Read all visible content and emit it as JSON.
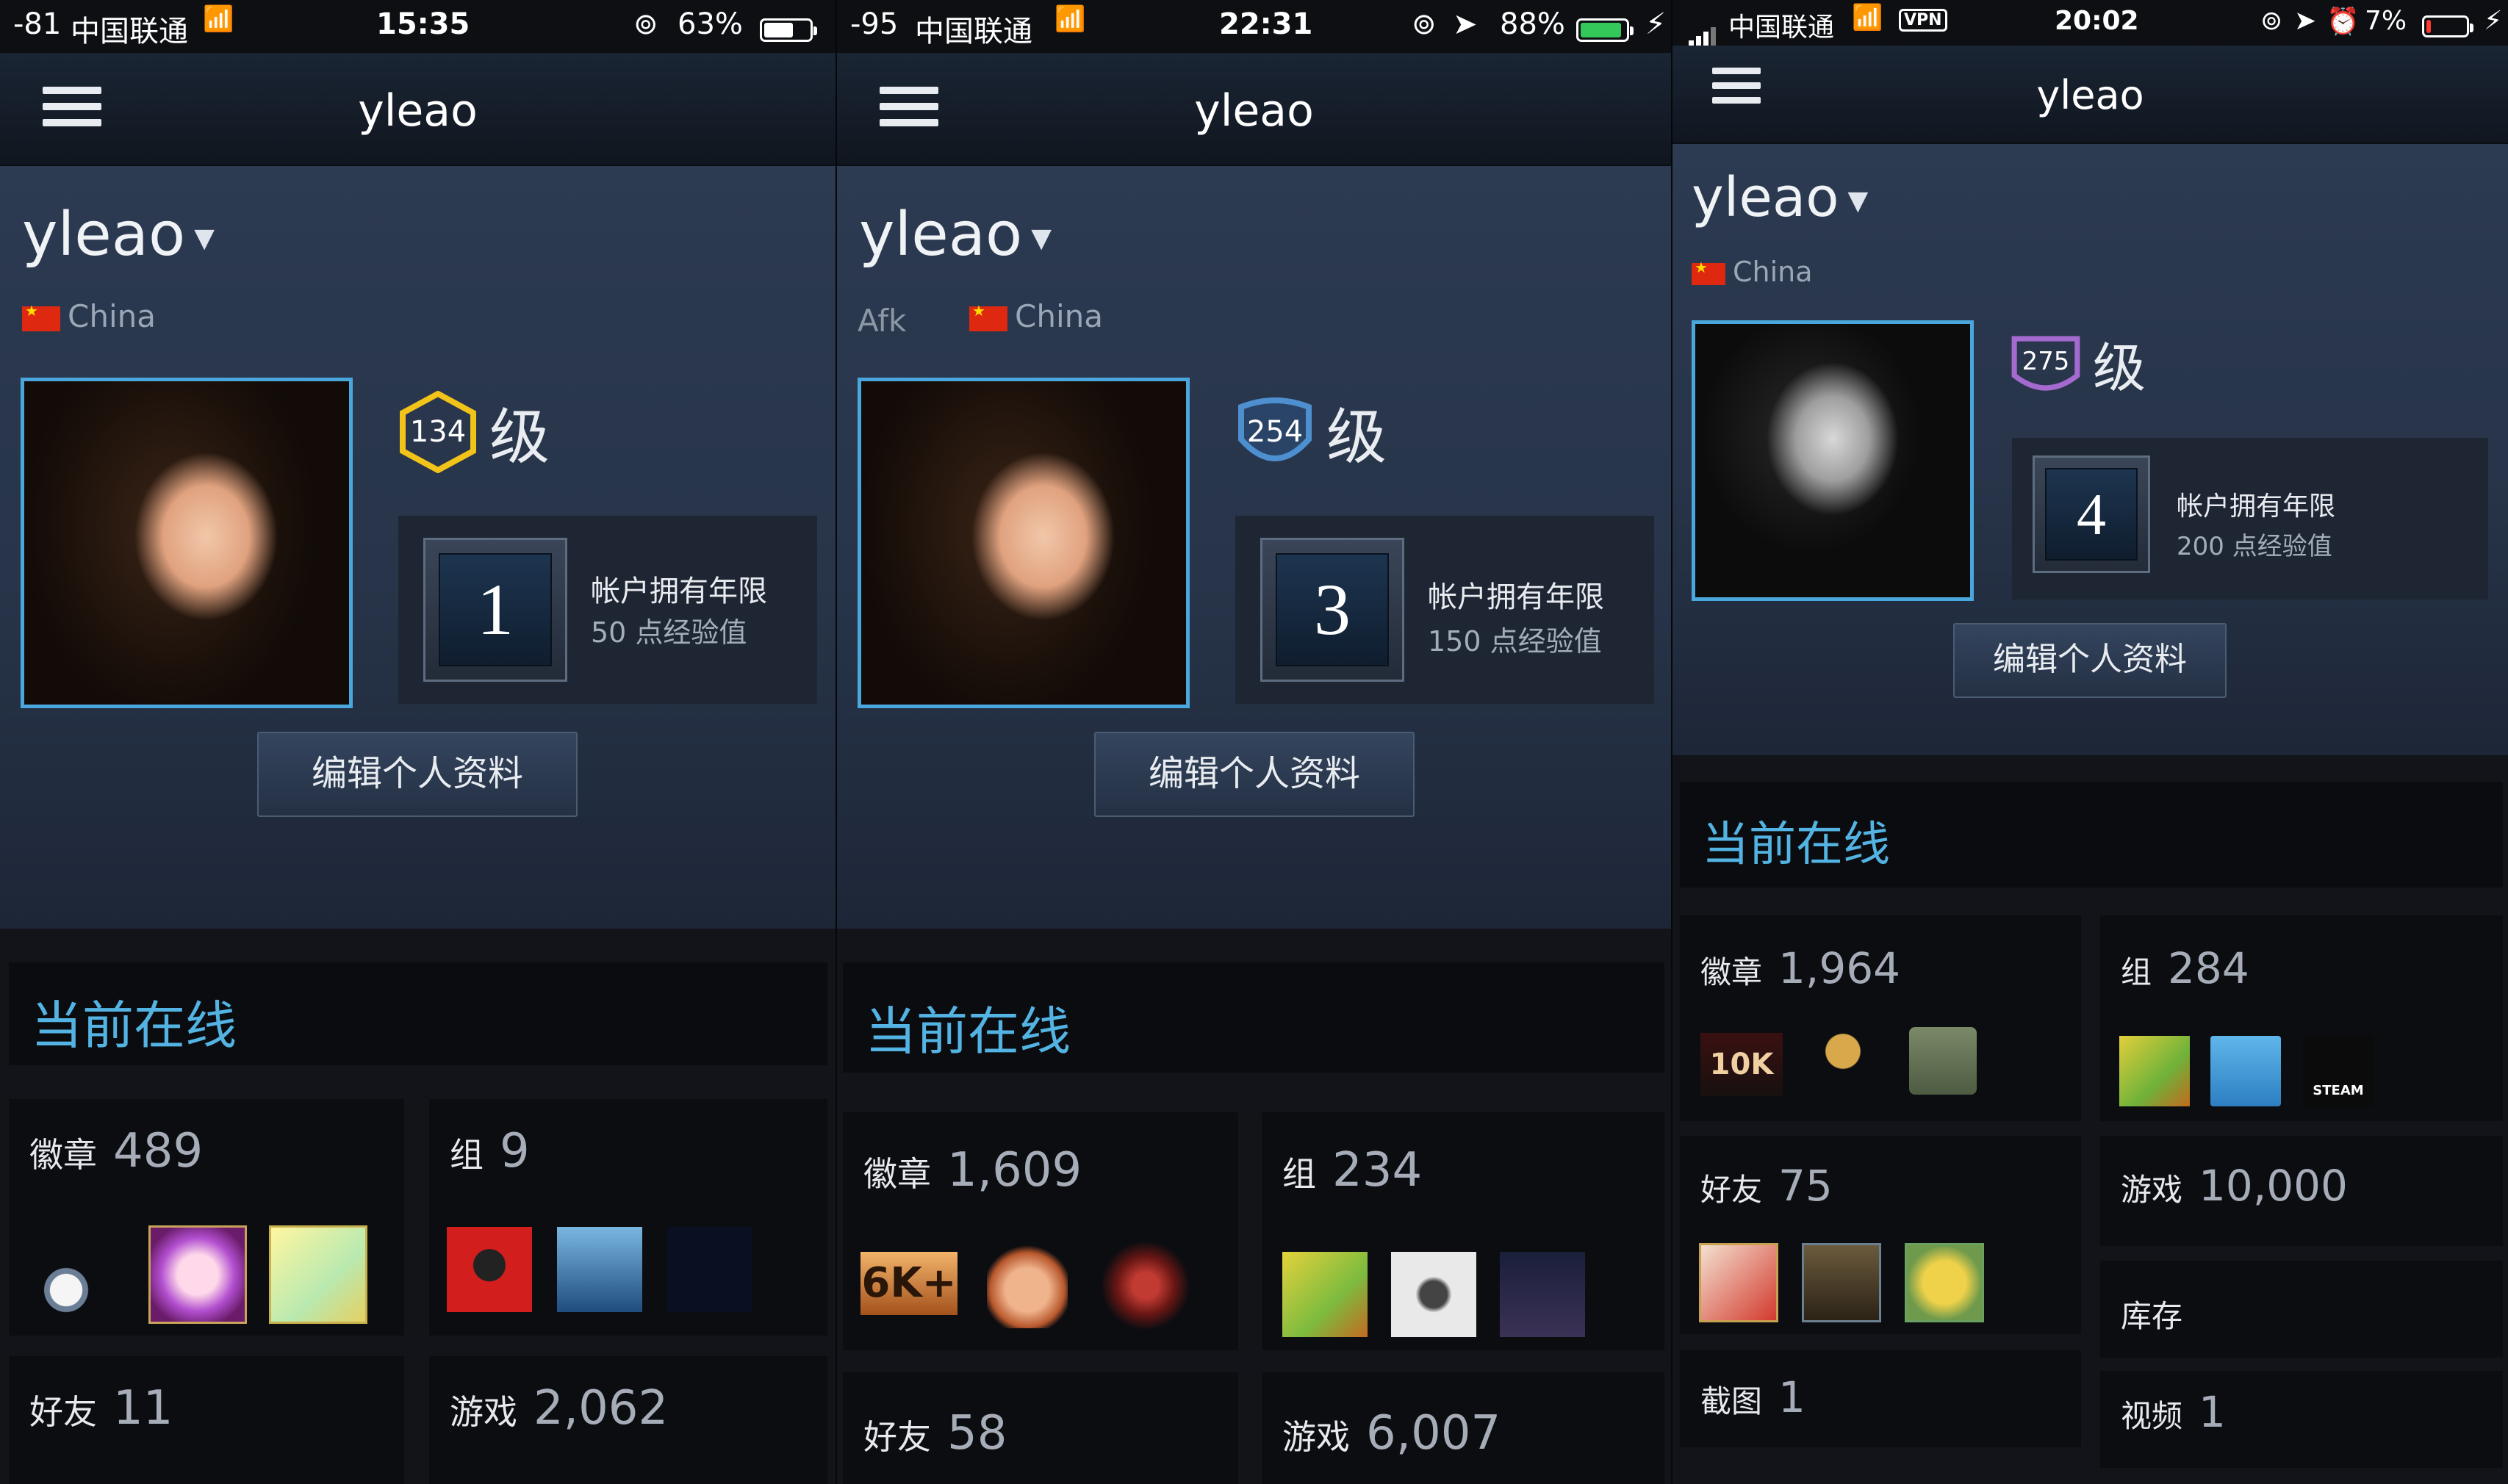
{
  "screens": [
    {
      "status": {
        "signal": "-81",
        "carrier": "中国联通",
        "time": "15:35",
        "battery": "63%"
      },
      "nav_title": "yleao",
      "persona_name": "yleao",
      "status_text": "",
      "country": "China",
      "level": "134",
      "level_suffix": "级",
      "years_number": "1",
      "years_title": "帐户拥有年限",
      "years_xp": "50 点经验值",
      "edit_profile": "编辑个人资料",
      "online_status": "当前在线",
      "stats": {
        "badges_label": "徽章",
        "badges_count": "489",
        "groups_label": "组",
        "groups_count": "9",
        "friends_label": "好友",
        "friends_count": "11",
        "games_label": "游戏",
        "games_count": "2,062"
      }
    },
    {
      "status": {
        "signal": "-95",
        "carrier": "中国联通",
        "time": "22:31",
        "battery": "88%"
      },
      "nav_title": "yleao",
      "persona_name": "yleao",
      "status_text": "Afk",
      "country": "China",
      "level": "254",
      "level_suffix": "级",
      "years_number": "3",
      "years_title": "帐户拥有年限",
      "years_xp": "150 点经验值",
      "edit_profile": "编辑个人资料",
      "online_status": "当前在线",
      "stats": {
        "badges_label": "徽章",
        "badges_count": "1,609",
        "groups_label": "组",
        "groups_count": "234",
        "friends_label": "好友",
        "friends_count": "58",
        "games_label": "游戏",
        "games_count": "6,007"
      },
      "badge_text": "6K+"
    },
    {
      "status": {
        "carrier": "中国联通",
        "vpn": "VPN",
        "time": "20:02",
        "battery": "7%"
      },
      "nav_title": "yleao",
      "persona_name": "yleao",
      "country": "China",
      "level": "275",
      "level_suffix": "级",
      "years_number": "4",
      "years_title": "帐户拥有年限",
      "years_xp": "200 点经验值",
      "edit_profile": "编辑个人资料",
      "online_status": "当前在线",
      "stats": {
        "badges_label": "徽章",
        "badges_count": "1,964",
        "groups_label": "组",
        "groups_count": "284",
        "friends_label": "好友",
        "friends_count": "75",
        "games_label": "游戏",
        "games_count": "10,000",
        "inventory_label": "库存",
        "screenshots_label": "截图",
        "screenshots_count": "1",
        "videos_label": "视频",
        "videos_count": "1"
      },
      "badge_text": "10K",
      "steam_text": "STEAM"
    }
  ],
  "colors": {
    "accent_blue": "#53b3e2",
    "avatar_border": "#4aa7dd",
    "level_134": "#f2c318",
    "level_254": "#4d8fcf",
    "level_275": "#a46ad0",
    "battery_green": "#34c759",
    "battery_red": "#ff3b30"
  },
  "icons": [
    "menu-icon",
    "wifi-icon",
    "lock-rotation-icon",
    "location-arrow-icon",
    "alarm-icon",
    "battery-icon",
    "charging-bolt-icon",
    "dropdown-caret-icon",
    "china-flag-icon"
  ]
}
